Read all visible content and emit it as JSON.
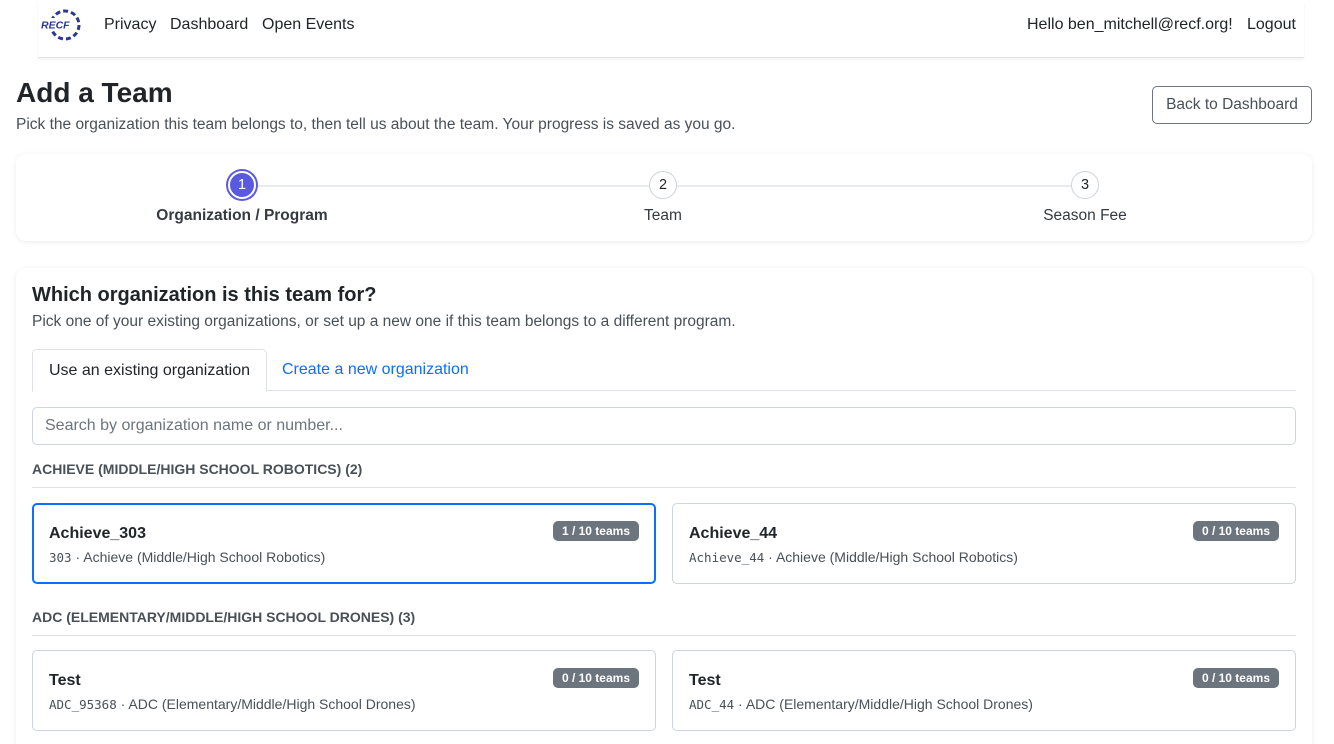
{
  "nav": {
    "logo_text": "RECF",
    "links": [
      "Privacy",
      "Dashboard",
      "Open Events"
    ],
    "greeting": "Hello ben_mitchell@recf.org!",
    "logout": "Logout"
  },
  "header": {
    "title": "Add a Team",
    "subtitle": "Pick the organization this team belongs to, then tell us about the team. Your progress is saved as you go.",
    "back_button": "Back to Dashboard"
  },
  "stepper": {
    "steps": [
      {
        "number": "1",
        "label": "Organization / Program",
        "active": true
      },
      {
        "number": "2",
        "label": "Team",
        "active": false
      },
      {
        "number": "3",
        "label": "Season Fee",
        "active": false
      }
    ]
  },
  "org_select": {
    "title": "Which organization is this team for?",
    "subtitle": "Pick one of your existing organizations, or set up a new one if this team belongs to a different program.",
    "tabs": [
      "Use an existing organization",
      "Create a new organization"
    ],
    "search_placeholder": "Search by organization name or number...",
    "groups": [
      {
        "header": "ACHIEVE (MIDDLE/HIGH SCHOOL ROBOTICS) (2)",
        "orgs": [
          {
            "name": "Achieve_303",
            "number": "303",
            "program": "Achieve (Middle/High School Robotics)",
            "badge": "1 / 10 teams",
            "selected": true
          },
          {
            "name": "Achieve_44",
            "number": "Achieve_44",
            "program": "Achieve (Middle/High School Robotics)",
            "badge": "0 / 10 teams",
            "selected": false
          }
        ]
      },
      {
        "header": "ADC (ELEMENTARY/MIDDLE/HIGH SCHOOL DRONES) (3)",
        "orgs": [
          {
            "name": "Test",
            "number": "ADC_95368",
            "program": "ADC (Elementary/Middle/High School Drones)",
            "badge": "0 / 10 teams",
            "selected": false
          },
          {
            "name": "Test",
            "number": "ADC_44",
            "program": "ADC (Elementary/Middle/High School Drones)",
            "badge": "0 / 10 teams",
            "selected": false
          }
        ]
      }
    ]
  },
  "colors": {
    "primary": "#0d6efd",
    "step_active": "#5a5ae0",
    "badge": "#6c757d",
    "logo": "#2b3a8c"
  }
}
